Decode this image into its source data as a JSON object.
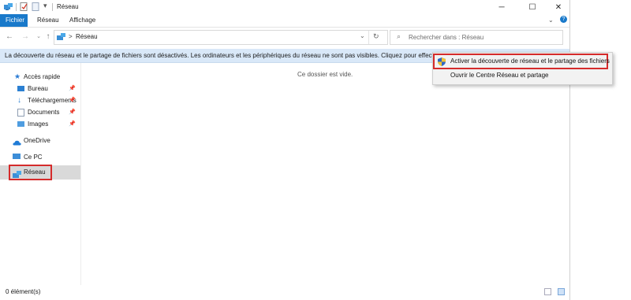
{
  "title": {
    "window_title": "Réseau"
  },
  "ribbon": {
    "tabs": [
      {
        "label": "Fichier"
      },
      {
        "label": "Réseau"
      },
      {
        "label": "Affichage"
      }
    ]
  },
  "address": {
    "path": "Réseau",
    "separator": ">"
  },
  "search": {
    "placeholder": "Rechercher dans : Réseau"
  },
  "infobar": {
    "text": "La découverte du réseau et le partage de fichiers sont désactivés. Les ordinateurs et les périphériques du réseau ne sont pas visibles. Cliquez pour effectuer la modi"
  },
  "sidebar": {
    "quick_access": "Accès rapide",
    "items": [
      {
        "label": "Bureau"
      },
      {
        "label": "Téléchargements"
      },
      {
        "label": "Documents"
      },
      {
        "label": "Images"
      }
    ],
    "onedrive": "OneDrive",
    "this_pc": "Ce PC",
    "network": "Réseau"
  },
  "content": {
    "empty_text": "Ce dossier est vide."
  },
  "context_menu": {
    "items": [
      {
        "label": "Activer la découverte de réseau et le partage des fichiers"
      },
      {
        "label": "Ouvrir le Centre Réseau et partage"
      }
    ]
  },
  "status": {
    "count": "0 élément(s)"
  },
  "colors": {
    "accent": "#1979ca",
    "infobar": "#d9e8f8",
    "highlight": "#d52b2b",
    "folder": "#e8b84a"
  }
}
